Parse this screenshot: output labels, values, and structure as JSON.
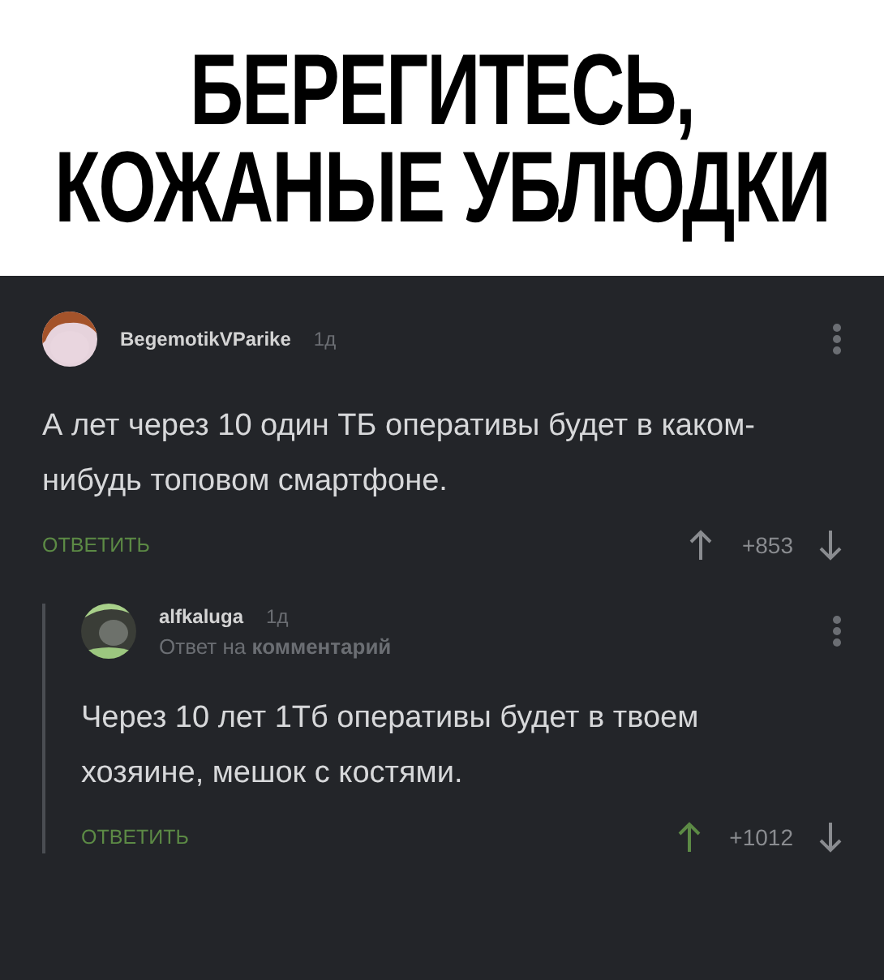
{
  "caption": [
    "БЕРЕГИТЕСЬ,",
    "КОЖАНЫЕ УБЛЮДКИ"
  ],
  "comments": [
    {
      "author": "BegemotikVParike",
      "age": "1д",
      "text": "А лет через 10 один ТБ оперативы будет в каком-нибудь топовом смартфоне.",
      "reply_label": "ОТВЕТИТЬ",
      "score": "+853",
      "upvoted": false,
      "children": [
        {
          "author": "alfkaluga",
          "age": "1д",
          "reply_to": {
            "prefix": "Ответ на",
            "link": "комментарий"
          },
          "text": "Через 10 лет 1Тб оперативы будет в твоем хозяине, мешок с костями.",
          "reply_label": "ОТВЕТИТЬ",
          "score": "+1012",
          "upvoted": true
        }
      ]
    }
  ]
}
